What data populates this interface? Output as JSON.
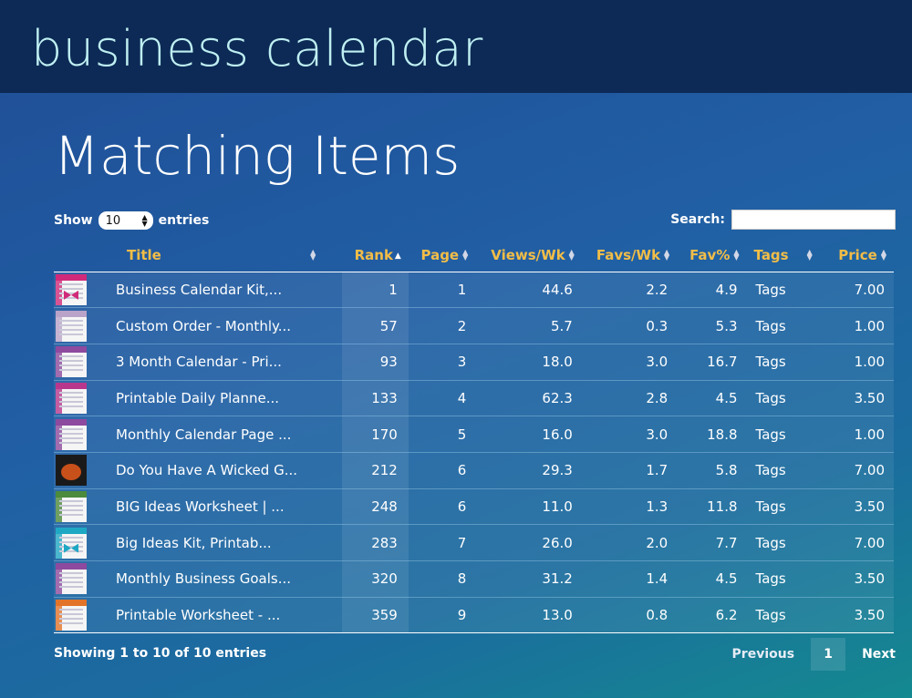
{
  "app": {
    "brand": "business calendar"
  },
  "page": {
    "title": "Matching Items"
  },
  "controls": {
    "show_label": "Show",
    "entries_value": "10",
    "entries_label": "entries",
    "search_label": "Search:",
    "search_value": ""
  },
  "table": {
    "columns": [
      "Title",
      "Rank",
      "Page",
      "Views/Wk",
      "Favs/Wk",
      "Fav%",
      "Tags",
      "Price"
    ],
    "sorted_column": "Rank",
    "rows": [
      {
        "thumb": "pink-ribbon",
        "title": "Business Calendar Kit,...",
        "rank": "1",
        "page": "1",
        "views": "44.6",
        "favs": "2.2",
        "favpct": "4.9",
        "tags": "Tags",
        "price": "7.00"
      },
      {
        "thumb": "plain-grid",
        "title": "Custom Order - Monthly...",
        "rank": "57",
        "page": "2",
        "views": "5.7",
        "favs": "0.3",
        "favpct": "5.3",
        "tags": "Tags",
        "price": "1.00"
      },
      {
        "thumb": "purple-sheet",
        "title": "3 Month Calendar - Pri...",
        "rank": "93",
        "page": "3",
        "views": "18.0",
        "favs": "3.0",
        "favpct": "16.7",
        "tags": "Tags",
        "price": "1.00"
      },
      {
        "thumb": "magenta-sheet",
        "title": "Printable Daily Planne...",
        "rank": "133",
        "page": "4",
        "views": "62.3",
        "favs": "2.8",
        "favpct": "4.5",
        "tags": "Tags",
        "price": "3.50"
      },
      {
        "thumb": "purple-sheet",
        "title": "Monthly Calendar Page ...",
        "rank": "170",
        "page": "5",
        "views": "16.0",
        "favs": "3.0",
        "favpct": "18.8",
        "tags": "Tags",
        "price": "1.00"
      },
      {
        "thumb": "dark-orange",
        "title": "Do You Have A Wicked G...",
        "rank": "212",
        "page": "6",
        "views": "29.3",
        "favs": "1.7",
        "favpct": "5.8",
        "tags": "Tags",
        "price": "7.00"
      },
      {
        "thumb": "green-sheet",
        "title": "BIG Ideas Worksheet | ...",
        "rank": "248",
        "page": "6",
        "views": "11.0",
        "favs": "1.3",
        "favpct": "11.8",
        "tags": "Tags",
        "price": "3.50"
      },
      {
        "thumb": "teal-ribbon",
        "title": "Big Ideas Kit, Printab...",
        "rank": "283",
        "page": "7",
        "views": "26.0",
        "favs": "2.0",
        "favpct": "7.7",
        "tags": "Tags",
        "price": "7.00"
      },
      {
        "thumb": "purple-sheet",
        "title": "Monthly Business Goals...",
        "rank": "320",
        "page": "8",
        "views": "31.2",
        "favs": "1.4",
        "favpct": "4.5",
        "tags": "Tags",
        "price": "3.50"
      },
      {
        "thumb": "orange-sheet",
        "title": "Printable Worksheet - ...",
        "rank": "359",
        "page": "9",
        "views": "13.0",
        "favs": "0.8",
        "favpct": "6.2",
        "tags": "Tags",
        "price": "3.50"
      }
    ]
  },
  "footer": {
    "info": "Showing 1 to 10 of 10 entries",
    "previous_label": "Previous",
    "current_page": "1",
    "next_label": "Next"
  },
  "colors": {
    "topbar": "#0c2a55",
    "brand_text": "#bfeff2",
    "header_text": "#f2bd47",
    "thumb_accents": {
      "pink-ribbon": "#d12a7a",
      "plain-grid": "#b9a3c9",
      "purple-sheet": "#8d4a9e",
      "magenta-sheet": "#b8378d",
      "dark-orange": "#c8501a",
      "green-sheet": "#4c8a3c",
      "teal-ribbon": "#1fa8c4",
      "orange-sheet": "#e2742a"
    }
  }
}
